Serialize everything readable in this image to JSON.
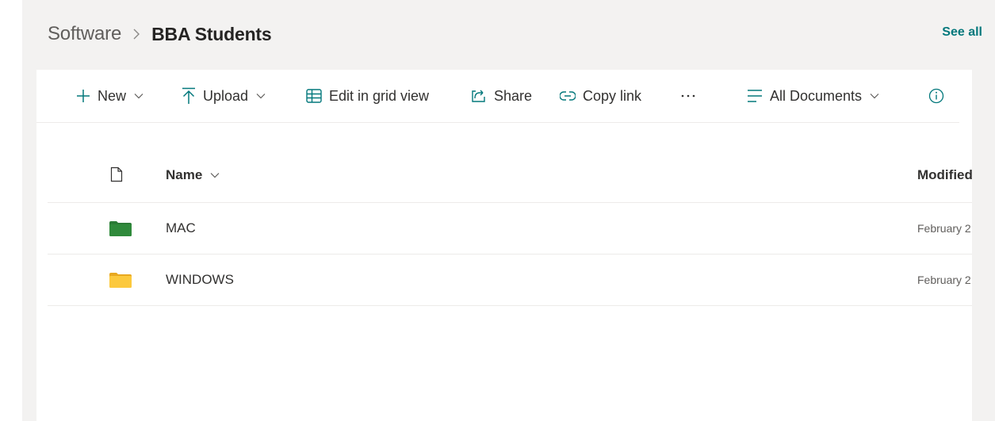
{
  "breadcrumb": {
    "parent": "Software",
    "separator_icon": "chevron-right-icon",
    "current": "BBA Students"
  },
  "header": {
    "see_all": "See all"
  },
  "toolbar": {
    "new_label": "New",
    "upload_label": "Upload",
    "edit_grid_label": "Edit in grid view",
    "share_label": "Share",
    "copy_link_label": "Copy link",
    "more_icon": "ellipsis-icon",
    "view_label": "All Documents",
    "info_icon": "info-icon"
  },
  "list": {
    "columns": {
      "name": "Name",
      "modified": "Modified"
    },
    "rows": [
      {
        "name": "MAC",
        "modified": "February 2",
        "folder_color": "#2b7b36"
      },
      {
        "name": "WINDOWS",
        "modified": "February 2",
        "folder_color": "#f8c53a"
      }
    ]
  },
  "colors": {
    "background": "#f3f2f1",
    "accent": "#03787c",
    "toolbar_icon": "#03787c"
  }
}
